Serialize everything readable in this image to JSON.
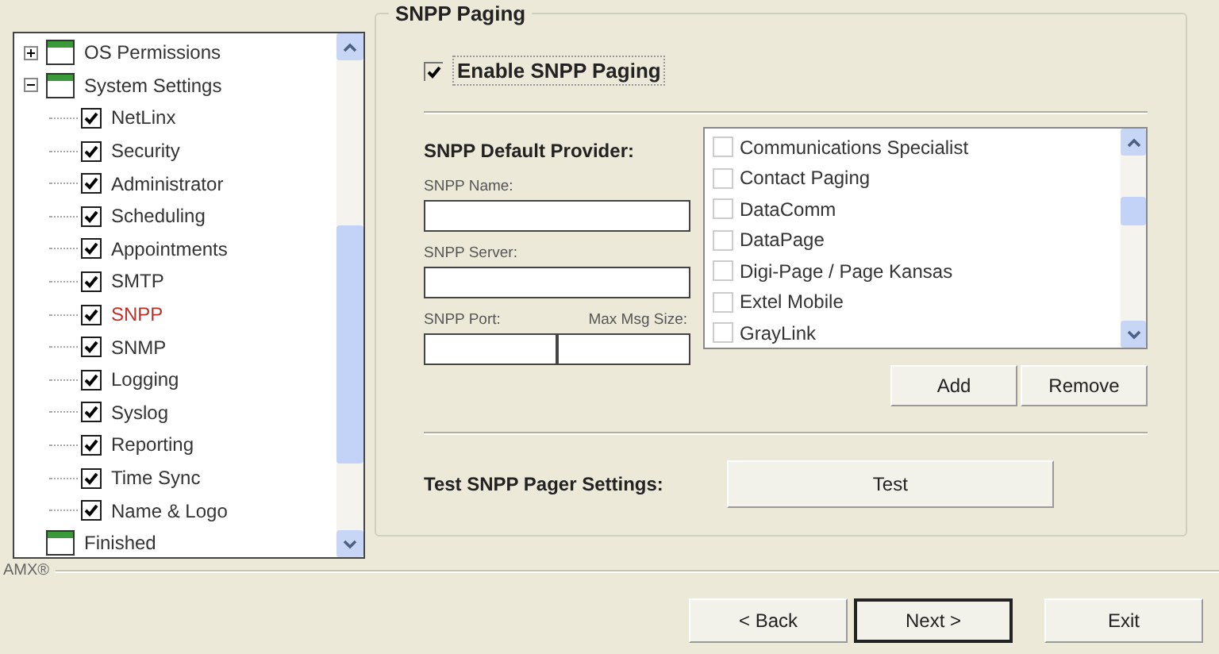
{
  "tree": {
    "items": [
      {
        "label": "OS Permissions",
        "kind": "folder",
        "expanded": false
      },
      {
        "label": "System Settings",
        "kind": "folder",
        "expanded": true,
        "children": [
          {
            "label": "NetLinx",
            "checked": true,
            "selected": false
          },
          {
            "label": "Security",
            "checked": true,
            "selected": false
          },
          {
            "label": "Administrator",
            "checked": true,
            "selected": false
          },
          {
            "label": "Scheduling",
            "checked": true,
            "selected": false
          },
          {
            "label": "Appointments",
            "checked": true,
            "selected": false
          },
          {
            "label": "SMTP",
            "checked": true,
            "selected": false
          },
          {
            "label": "SNPP",
            "checked": true,
            "selected": true
          },
          {
            "label": "SNMP",
            "checked": true,
            "selected": false
          },
          {
            "label": "Logging",
            "checked": true,
            "selected": false
          },
          {
            "label": "Syslog",
            "checked": true,
            "selected": false
          },
          {
            "label": "Reporting",
            "checked": true,
            "selected": false
          },
          {
            "label": "Time Sync",
            "checked": true,
            "selected": false
          },
          {
            "label": "Name & Logo",
            "checked": true,
            "selected": false
          }
        ]
      },
      {
        "label": "Finished",
        "kind": "page"
      }
    ]
  },
  "group": {
    "title": "SNPP Paging",
    "enable": {
      "label": "Enable SNPP Paging",
      "checked": true
    },
    "provider_label": "SNPP Default Provider:",
    "name_field": {
      "label": "SNPP Name:"
    },
    "server_field": {
      "label": "SNPP Server:"
    },
    "port_field": {
      "label": "SNPP Port:"
    },
    "size_field": {
      "label": "Max Msg Size:"
    },
    "providers": [
      {
        "label": "Communications Specialist",
        "checked": false
      },
      {
        "label": "Contact Paging",
        "checked": false
      },
      {
        "label": "DataComm",
        "checked": false
      },
      {
        "label": "DataPage",
        "checked": false
      },
      {
        "label": "Digi-Page / Page Kansas",
        "checked": false
      },
      {
        "label": "Extel Mobile",
        "checked": false
      },
      {
        "label": "GrayLink",
        "checked": false
      }
    ],
    "list_buttons": [
      "Add",
      "Remove"
    ],
    "test_label": "Test SNPP Pager Settings:",
    "test_button": "Test"
  },
  "brand": "AMX®",
  "nav_buttons": [
    {
      "label": "< Back",
      "default": false
    },
    {
      "label": "Next >",
      "default": true
    },
    {
      "label": "Exit",
      "default": false
    }
  ]
}
